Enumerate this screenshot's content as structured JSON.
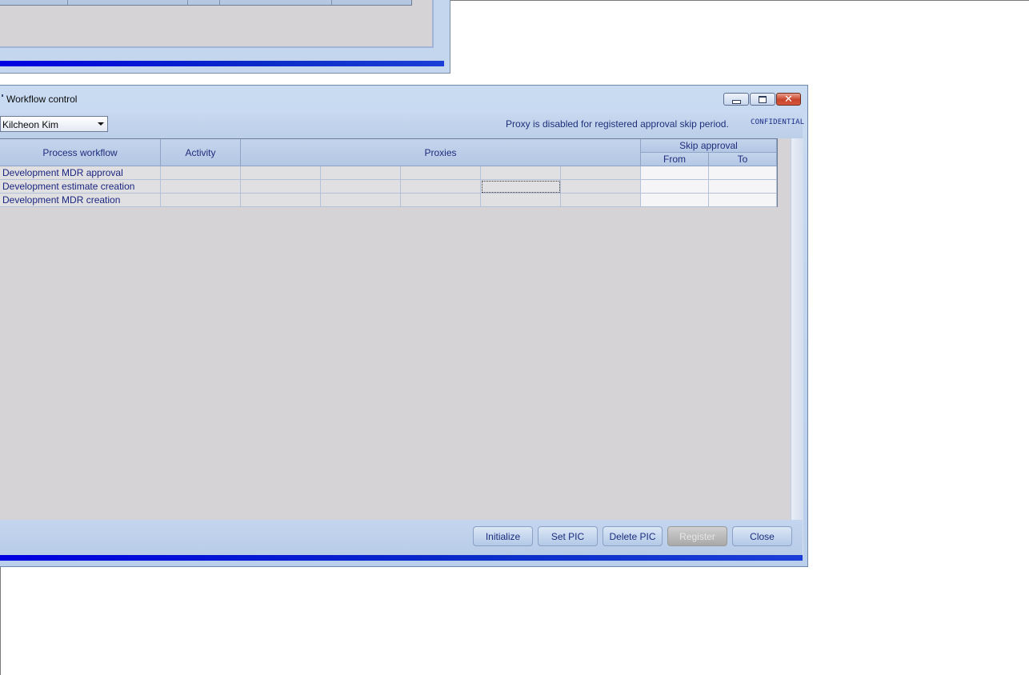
{
  "background_window": {
    "header_columns": [
      "",
      "",
      "",
      "",
      ""
    ]
  },
  "window": {
    "title": "Workflow control",
    "controls": {
      "minimize": "minimize",
      "maximize": "maximize",
      "close": "close"
    }
  },
  "toolbar": {
    "user_select": "Kilcheon Kim",
    "notice": "Proxy is disabled for registered approval skip period.",
    "confidential": "CONFIDENTIAL"
  },
  "grid": {
    "headers": {
      "process_workflow": "Process workflow",
      "activity": "Activity",
      "proxies": "Proxies",
      "skip_approval": "Skip approval",
      "from": "From",
      "to": "To"
    },
    "rows": [
      {
        "process_workflow": "Development MDR approval"
      },
      {
        "process_workflow": "Development estimate creation"
      },
      {
        "process_workflow": "Development MDR creation"
      }
    ]
  },
  "buttons": {
    "initialize": "Initialize",
    "set_pic": "Set PIC",
    "delete_pic": "Delete PIC",
    "register": "Register",
    "close": "Close"
  },
  "colors": {
    "accent_bar": "#0000e0",
    "header_text": "#1e2d7c",
    "panel_bg": "#d6d3d7"
  }
}
